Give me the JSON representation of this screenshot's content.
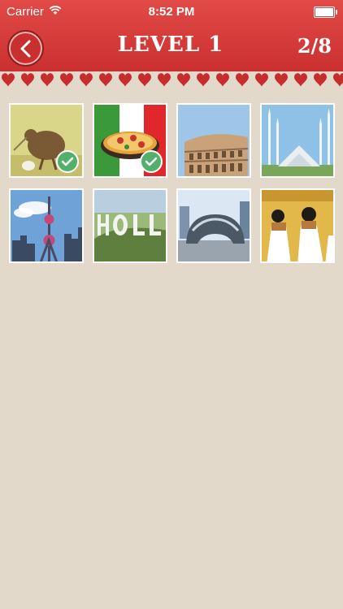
{
  "status": {
    "carrier": "Carrier",
    "time": "8:52 PM"
  },
  "header": {
    "title": "LEVEL 1",
    "progress": "2/8"
  },
  "colors": {
    "header_red": "#d43b3a",
    "background": "#e3d9cb",
    "check_green": "#52b06b"
  },
  "tiles": [
    {
      "name": "kiwi",
      "solved": true
    },
    {
      "name": "pizza-italy",
      "solved": true
    },
    {
      "name": "colosseum",
      "solved": false
    },
    {
      "name": "faisal-mosque",
      "solved": false
    },
    {
      "name": "shanghai-tower",
      "solved": false
    },
    {
      "name": "hollywood-sign",
      "solved": false
    },
    {
      "name": "cloud-gate",
      "solved": false
    },
    {
      "name": "egyptian-art",
      "solved": false
    }
  ]
}
